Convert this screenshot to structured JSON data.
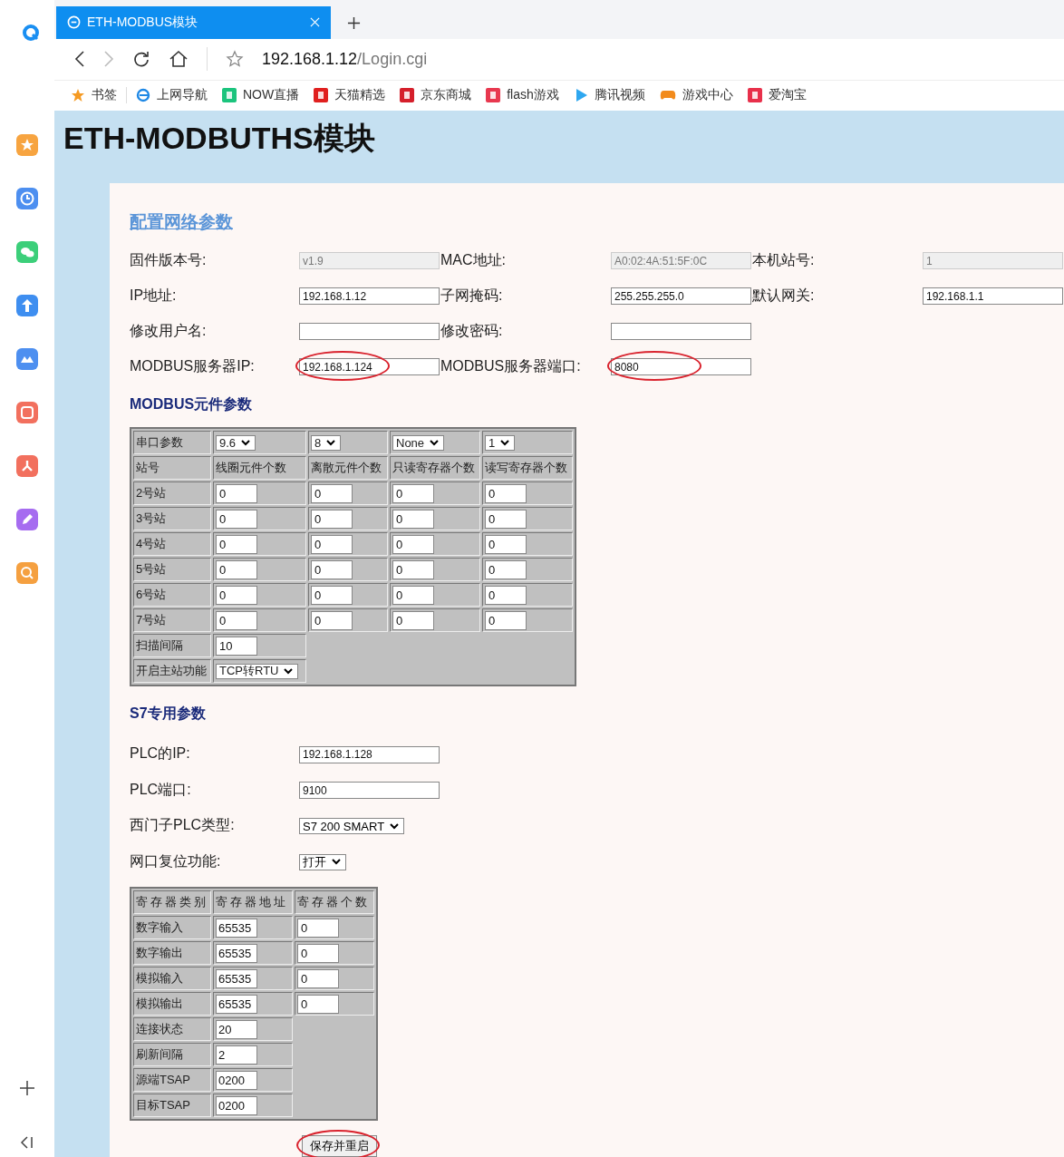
{
  "browser": {
    "tab": {
      "title": "ETH-MODBUS模块",
      "selected": true
    },
    "address": {
      "host": "192.168.1.12",
      "path": "/Login.cgi"
    },
    "bookmarks": [
      {
        "label": "书签",
        "kind": "star"
      },
      {
        "label": "上网导航",
        "kind": "ie"
      },
      {
        "label": "NOW直播",
        "kind": "now"
      },
      {
        "label": "天猫精选",
        "kind": "tmall"
      },
      {
        "label": "京东商城",
        "kind": "jd"
      },
      {
        "label": "flash游戏",
        "kind": "flash"
      },
      {
        "label": "腾讯视频",
        "kind": "video"
      },
      {
        "label": "游戏中心",
        "kind": "game"
      },
      {
        "label": "爱淘宝",
        "kind": "taobao"
      }
    ]
  },
  "page": {
    "title": "ETH-MODBUTHS模块",
    "network": {
      "heading": "配置网络参数",
      "rows": [
        [
          {
            "label": "固件版本号:",
            "value": "v1.9",
            "disabled": true
          },
          {
            "label": "MAC地址:",
            "value": "A0:02:4A:51:5F:0C",
            "disabled": true
          },
          {
            "label": "本机站号:",
            "value": "1",
            "disabled": true
          }
        ],
        [
          {
            "label": "IP地址:",
            "value": "192.168.1.12",
            "disabled": false
          },
          {
            "label": "子网掩码:",
            "value": "255.255.255.0",
            "disabled": false
          },
          {
            "label": "默认网关:",
            "value": "192.168.1.1",
            "disabled": false
          }
        ],
        [
          {
            "label": "修改用户名:",
            "disabled": false
          },
          {
            "label": "修改密码:",
            "disabled": false
          }
        ],
        [
          {
            "label": "MODBUS服务器IP:",
            "value": "192.168.1.124",
            "disabled": false,
            "circled": true
          },
          {
            "label": "MODBUS服务器端口:",
            "value": "8080",
            "disabled": false,
            "circled": true
          }
        ]
      ]
    },
    "modbus": {
      "heading": "MODBUS元件参数",
      "serial": {
        "label": "串口参数",
        "selects": [
          "9.6",
          "8",
          "None",
          "1"
        ]
      },
      "columns": [
        "站号",
        "线圈元件个数",
        "离散元件个数",
        "只读寄存器个数",
        "读写寄存器个数"
      ],
      "stations": [
        {
          "name": "2号站",
          "values": [
            "0",
            "0",
            "0",
            "0"
          ]
        },
        {
          "name": "3号站",
          "values": [
            "0",
            "0",
            "0",
            "0"
          ]
        },
        {
          "name": "4号站",
          "values": [
            "0",
            "0",
            "0",
            "0"
          ]
        },
        {
          "name": "5号站",
          "values": [
            "0",
            "0",
            "0",
            "0"
          ]
        },
        {
          "name": "6号站",
          "values": [
            "0",
            "0",
            "0",
            "0"
          ]
        },
        {
          "name": "7号站",
          "values": [
            "0",
            "0",
            "0",
            "0"
          ]
        }
      ],
      "scan": {
        "label": "扫描间隔",
        "value": "10"
      },
      "master": {
        "label": "开启主站功能",
        "value": "TCP转RTU"
      }
    },
    "s7": {
      "heading": "S7专用参数",
      "fields": [
        {
          "label": "PLC的IP:",
          "value": "192.168.1.128",
          "kind": "input"
        },
        {
          "label": "PLC端口:",
          "value": "9100",
          "kind": "input"
        },
        {
          "label": "西门子PLC类型:",
          "value": "S7 200 SMART",
          "kind": "select"
        },
        {
          "label": "网口复位功能:",
          "value": "打开",
          "kind": "select"
        }
      ],
      "registers": {
        "columns": [
          "寄存器类别",
          "寄存器地址",
          "寄存器个数"
        ],
        "rows": [
          {
            "name": "数字输入",
            "address": "65535",
            "count": "0"
          },
          {
            "name": "数字输出",
            "address": "65535",
            "count": "0"
          },
          {
            "name": "模拟输入",
            "address": "65535",
            "count": "0"
          },
          {
            "name": "模拟输出",
            "address": "65535",
            "count": "0"
          }
        ],
        "extra": [
          {
            "name": "连接状态",
            "value": "20"
          },
          {
            "name": "刷新间隔",
            "value": "2"
          },
          {
            "name": "源端TSAP",
            "value": "0200"
          },
          {
            "name": "目标TSAP",
            "value": "0200"
          }
        ]
      }
    },
    "save_button": {
      "label": "保存并重启",
      "circled": true
    }
  }
}
